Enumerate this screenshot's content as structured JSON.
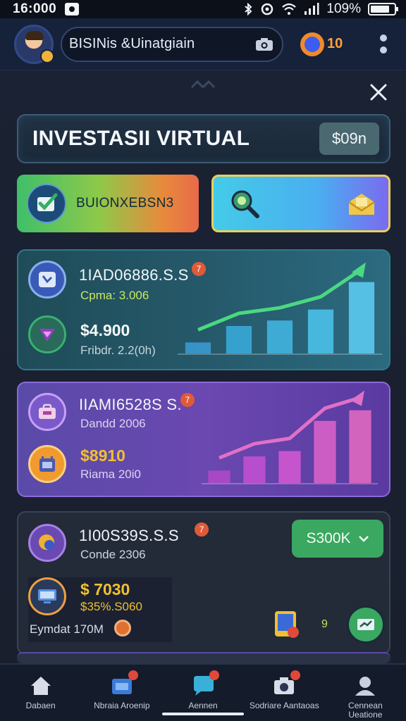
{
  "status_bar": {
    "time": "16:000",
    "battery": "109%",
    "icons": [
      "notification-icon",
      "bluetooth-icon",
      "alarm-icon",
      "wifi-icon",
      "signal-icon",
      "battery-icon"
    ]
  },
  "header": {
    "search_text": "BISINis &Uinatgiain",
    "coin_value": "10",
    "icons": [
      "avatar",
      "camera-icon",
      "coin-icon",
      "kebab-menu-icon"
    ]
  },
  "panel": {
    "title": "INVESTASII VIRTUAL",
    "balance": "$09n",
    "action_a_label": "BUIONXEBSN3"
  },
  "cards": [
    {
      "title": "1IAD06886.S.S",
      "badge": "7",
      "subtitle": "Cpma: 3.006",
      "amount": "$4.900",
      "detail": "Fribdr. 2.2(0h)",
      "accent": "#c8e860",
      "chart_values": [
        0.12,
        0.3,
        0.36,
        0.48,
        0.78
      ]
    },
    {
      "title": "IIAMI6528S S.",
      "badge": "7",
      "subtitle": "Dandd 2006",
      "amount": "$8910",
      "detail": "Riama 20i0",
      "accent": "#f0c030",
      "chart_values": [
        0.14,
        0.3,
        0.36,
        0.7,
        0.82
      ]
    },
    {
      "title": "1I00S39S.S.S",
      "badge": "7",
      "subtitle": "Conde 2306",
      "amount": "$ 7030",
      "amount2": "$35%.S060",
      "detail": "Eymdat 170M",
      "dropdown": "S300K",
      "small_badge": "9"
    }
  ],
  "bottom_nav": [
    {
      "label": "Dabaen",
      "icon": "home-icon"
    },
    {
      "label": "Nbraia Aroenip",
      "icon": "shop-icon"
    },
    {
      "label": "Aennen",
      "icon": "chat-icon"
    },
    {
      "label": "Sodriare Aantaoas",
      "icon": "camera-icon"
    },
    {
      "label": "Cennean Ueatione",
      "icon": "profile-icon"
    }
  ]
}
